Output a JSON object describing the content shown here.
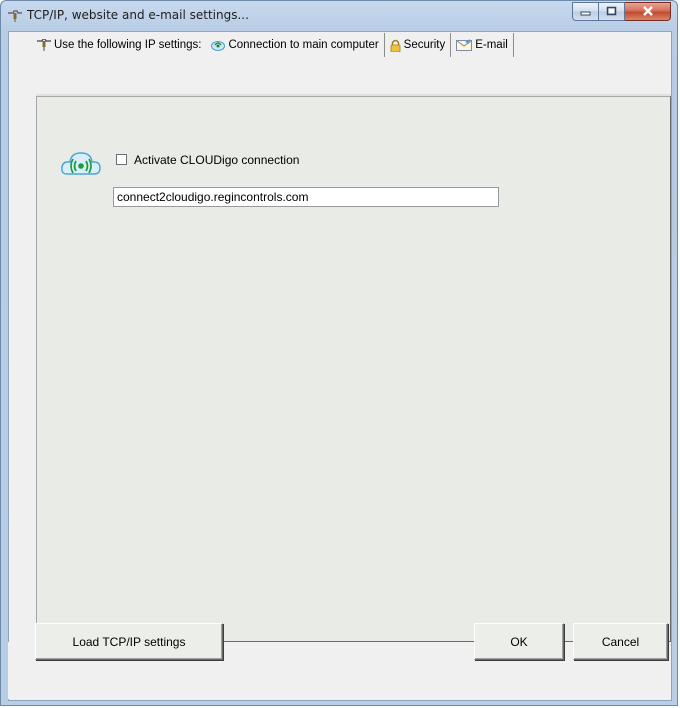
{
  "window": {
    "title": "TCP/IP, website and e-mail settings...",
    "icon": "network-plug-icon",
    "controls": [
      "minimize-icon",
      "maximize-icon",
      "close-icon"
    ]
  },
  "tabs": [
    {
      "label": "Use the following IP settings:",
      "icon": "network-plug-icon",
      "selected": false
    },
    {
      "label": "Connection to main computer",
      "icon": "connection-icon",
      "selected": true
    },
    {
      "label": "Security",
      "icon": "lock-icon",
      "selected": false
    },
    {
      "label": "E-mail",
      "icon": "envelope-icon",
      "selected": false
    }
  ],
  "connection": {
    "icon": "cloud-signal-icon",
    "activate_label": "Activate CLOUDigo connection",
    "activate_checked": false,
    "host_value": "connect2cloudigo.regincontrols.com"
  },
  "buttons": {
    "load": "Load TCP/IP settings",
    "ok": "OK",
    "cancel": "Cancel"
  },
  "colors": {
    "titlebar": "#b9cde6",
    "panel": "#e9ece6",
    "close_button": "#c24a30"
  }
}
